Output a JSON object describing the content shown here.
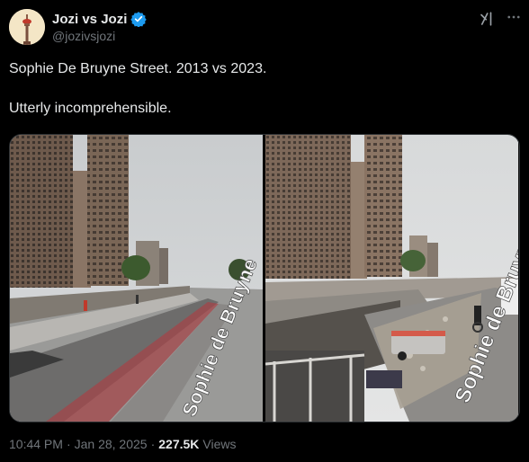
{
  "author": {
    "name": "Jozi vs Jozi",
    "handle": "@jozivsjozi",
    "verified": true,
    "avatar_icon": "hillbrow-tower-icon"
  },
  "tweet": {
    "line1": "Sophie De Bruyne Street. 2013 vs 2023.",
    "line2": "Utterly incomprehensible."
  },
  "media": {
    "left_street_sign": "Sophie de Bruyne",
    "right_street_sign": "Sophie de Bruyne"
  },
  "meta": {
    "time": "10:44 PM",
    "separator1": "·",
    "date": "Jan 28, 2025",
    "separator2": "·",
    "views_count": "227.5K",
    "views_label": "Views"
  },
  "colors": {
    "background": "#000000",
    "text_primary": "#e7e9ea",
    "text_secondary": "#71767b",
    "verified_blue": "#1d9bf0",
    "border": "#2f3336"
  }
}
